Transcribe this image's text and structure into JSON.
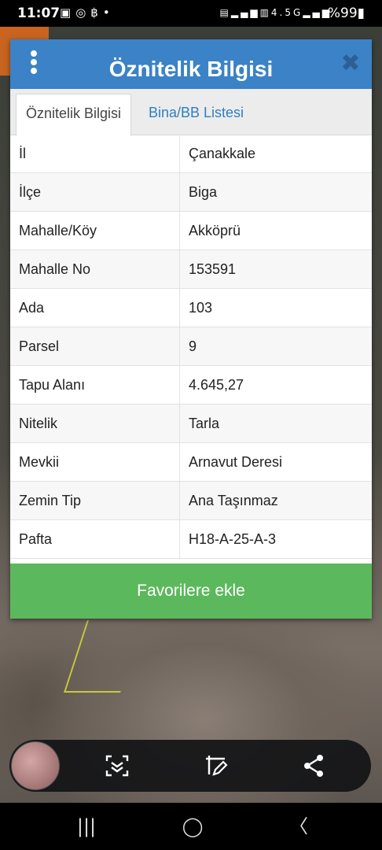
{
  "status_bar": {
    "time": "11:07",
    "left_icons": [
      "gallery-icon",
      "instagram-icon",
      "bitcoin-icon",
      "dot-icon"
    ],
    "right_icons": [
      "sim-icon",
      "signal-icon",
      "volte-icon",
      "4.5G",
      "signal-icon"
    ],
    "battery": "%99"
  },
  "dialog": {
    "title": "Öznitelik Bilgisi",
    "header_color": "#3b82c6",
    "tabs": [
      {
        "label": "Öznitelik Bilgisi",
        "active": true
      },
      {
        "label": "Bina/BB Listesi",
        "active": false
      }
    ],
    "rows": [
      {
        "label": "İl",
        "value": "Çanakkale"
      },
      {
        "label": "İlçe",
        "value": "Biga"
      },
      {
        "label": "Mahalle/Köy",
        "value": "Akköprü"
      },
      {
        "label": "Mahalle No",
        "value": "153591"
      },
      {
        "label": "Ada",
        "value": "103"
      },
      {
        "label": "Parsel",
        "value": "9"
      },
      {
        "label": "Tapu Alanı",
        "value": "4.645,27"
      },
      {
        "label": "Nitelik",
        "value": "Tarla"
      },
      {
        "label": "Mevkii",
        "value": "Arnavut Deresi"
      },
      {
        "label": "Zemin Tip",
        "value": "Ana Taşınmaz"
      },
      {
        "label": "Pafta",
        "value": "H18-A-25-A-3"
      }
    ],
    "favorite_button": "Favorilere ekle",
    "favorite_color": "#5cb85c"
  },
  "toolbar": {
    "icons": [
      "scan-icon",
      "edit-icon",
      "share-icon"
    ]
  },
  "navbar": {
    "icons": [
      "recent-apps-icon",
      "home-icon",
      "back-icon"
    ]
  }
}
